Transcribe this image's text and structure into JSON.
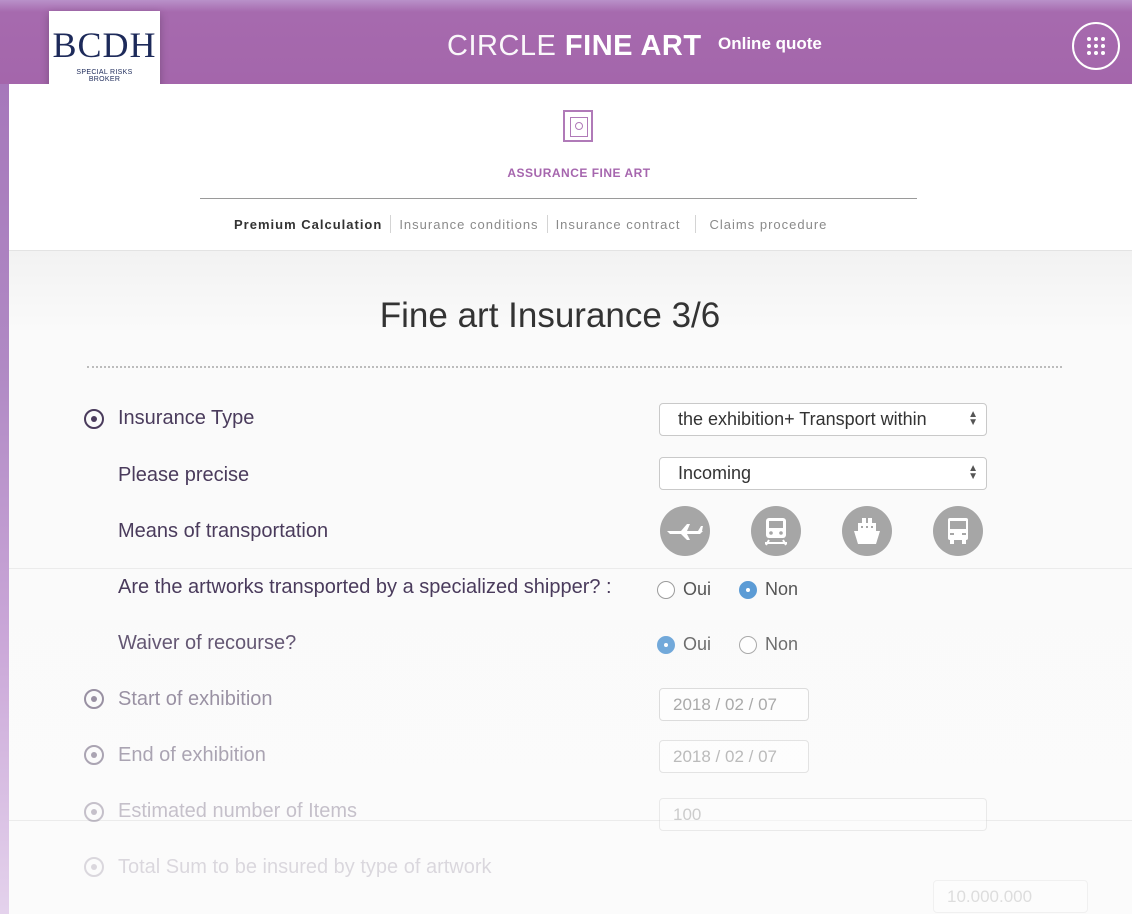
{
  "header": {
    "logo_mark": "BCDH",
    "logo_subtitle": "SPECIAL RISKS BROKER",
    "brand_light": "CIRCLE",
    "brand_bold": "FINE ART",
    "brand_sub": "Online quote",
    "menu_icon": "grid-menu-icon"
  },
  "section": {
    "icon": "frame-portrait-icon",
    "title": "ASSURANCE FINE ART"
  },
  "subnav": [
    {
      "label": "Premium Calculation",
      "active": true
    },
    {
      "label": "Insurance conditions",
      "active": false
    },
    {
      "label": "Insurance contract",
      "active": false
    },
    {
      "label": "Claims procedure",
      "active": false
    }
  ],
  "page": {
    "title": "Fine art Insurance 3/6"
  },
  "form": {
    "insurance_type": {
      "label": "Insurance Type",
      "value": "the exhibition+ Transport within"
    },
    "precise": {
      "label": "Please precise",
      "value": "Incoming"
    },
    "transport": {
      "label": "Means of transportation",
      "options": [
        "plane-icon",
        "train-icon",
        "ship-icon",
        "truck-icon"
      ]
    },
    "shipper": {
      "label": "Are the artworks transported by a specialized shipper? :",
      "options": [
        "Oui",
        "Non"
      ],
      "selected": "Non"
    },
    "waiver": {
      "label": "Waiver of recourse?",
      "options": [
        "Oui",
        "Non"
      ],
      "selected": "Oui"
    },
    "start": {
      "label": "Start of exhibition",
      "value": "2018 / 02 / 07"
    },
    "end": {
      "label": "End of exhibition",
      "value": "2018 / 02 / 07"
    },
    "items": {
      "label": "Estimated number of Items",
      "value": "100"
    },
    "sum": {
      "label": "Total Sum to be insured by type of artwork",
      "value": "10.000.000"
    }
  },
  "colors": {
    "accent": "#a466ab",
    "radio_selected": "#5b9bd5",
    "label_text": "#4a3b5c"
  }
}
